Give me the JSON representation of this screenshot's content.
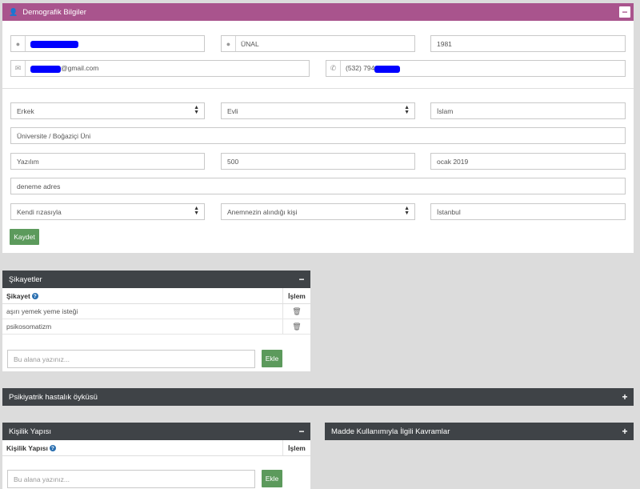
{
  "demografik": {
    "title": "Demografik Bilgiler",
    "toggle": "−",
    "surname": "ÜNAL",
    "birth_year": "1981",
    "email_suffix": "@gmail.com",
    "phone_prefix": "(532) 794",
    "gender": "Erkek",
    "marital": "Evli",
    "religion": "İslam",
    "education": "Üniversite / Boğaziçi Üni",
    "job": "Yazılım",
    "income": "500",
    "date": "ocak 2019",
    "address": "deneme adres",
    "admission": "Kendi rızasıyla",
    "source": "Anemnezin alındığı kişi",
    "city": "İstanbul",
    "save_label": "Kaydet"
  },
  "sikayetler": {
    "title": "Şikayetler",
    "toggle": "−",
    "col_label": "Şikayet",
    "col_action": "İşlem",
    "rows": [
      "aşırı yemek yeme isteği",
      "psikosomatizm"
    ],
    "input_placeholder": "Bu alana yazınız...",
    "add_label": "Ekle"
  },
  "psikiyatrik": {
    "title": "Psikiyatrik hastalık öyküsü",
    "toggle": "+"
  },
  "kisilik": {
    "title": "Kişilik Yapısı",
    "toggle": "−",
    "col_label": "Kişilik Yapısı",
    "col_action": "İşlem",
    "input_placeholder": "Bu alana yazınız...",
    "add_label": "Ekle"
  },
  "madde": {
    "title": "Madde Kullanımıyla İlgili Kavramlar",
    "toggle": "+"
  },
  "colors": {
    "purple_header": "#a9548d",
    "dark_header": "#3f4347",
    "green_button": "#5c9a5c",
    "redaction": "#0000ff"
  }
}
